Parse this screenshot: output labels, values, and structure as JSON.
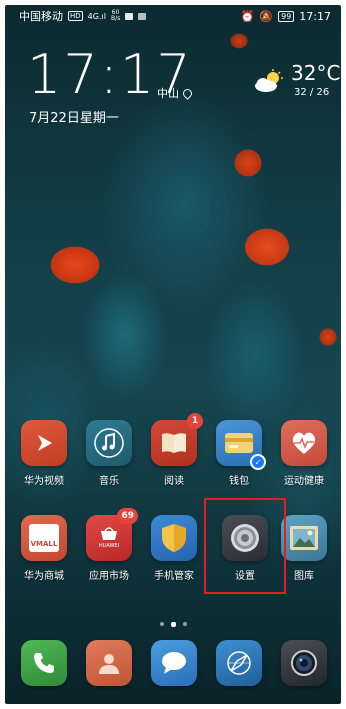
{
  "status_bar": {
    "carrier": "中国移动",
    "network_badge": "HD",
    "signal": "4G",
    "net_speed_value": "60",
    "net_speed_unit": "B/s",
    "battery": "99",
    "time": "17:17",
    "icons": [
      "signal-icon",
      "alarm-icon",
      "mute-icon",
      "battery-icon"
    ]
  },
  "clock_widget": {
    "time": "17:17",
    "city": "中山",
    "date": "7月22日星期一",
    "temperature": "32°C",
    "temp_range": "32 / 26",
    "weather_icon": "partly-cloudy-icon"
  },
  "apps_row1": [
    {
      "label": "华为视频",
      "icon": "video-icon",
      "color": "#d4482d"
    },
    {
      "label": "音乐",
      "icon": "music-icon",
      "color": "#2a6f86"
    },
    {
      "label": "阅读",
      "icon": "book-icon",
      "color": "#c73a2a",
      "badge": "1"
    },
    {
      "label": "钱包",
      "icon": "wallet-icon",
      "color": "#3585c9"
    },
    {
      "label": "运动健康",
      "icon": "health-icon",
      "color": "#d9574a"
    }
  ],
  "apps_row2": [
    {
      "label": "华为商城",
      "icon": "vmall-icon",
      "color": "#c9513a",
      "icon_text": "VMALL"
    },
    {
      "label": "应用市场",
      "icon": "appgallery-icon",
      "color": "#d23a3a",
      "badge": "69",
      "icon_text": "HUAWEI"
    },
    {
      "label": "手机管家",
      "icon": "shield-icon",
      "color": "#2f79c9"
    },
    {
      "label": "设置",
      "icon": "settings-icon",
      "color": "#3a3d42"
    },
    {
      "label": "图库",
      "icon": "gallery-icon",
      "color": "#4f8fb0"
    }
  ],
  "dock": [
    {
      "name": "phone",
      "icon": "phone-icon",
      "color": "#3fa647"
    },
    {
      "name": "contacts",
      "icon": "contacts-icon",
      "color": "#d96b4b"
    },
    {
      "name": "messages",
      "icon": "message-icon",
      "color": "#3b8fd6"
    },
    {
      "name": "browser",
      "icon": "browser-icon",
      "color": "#2f7fc0"
    },
    {
      "name": "camera",
      "icon": "camera-icon",
      "color": "#3b3f46"
    }
  ],
  "page_indicator": {
    "pages": 3,
    "active": 2
  }
}
